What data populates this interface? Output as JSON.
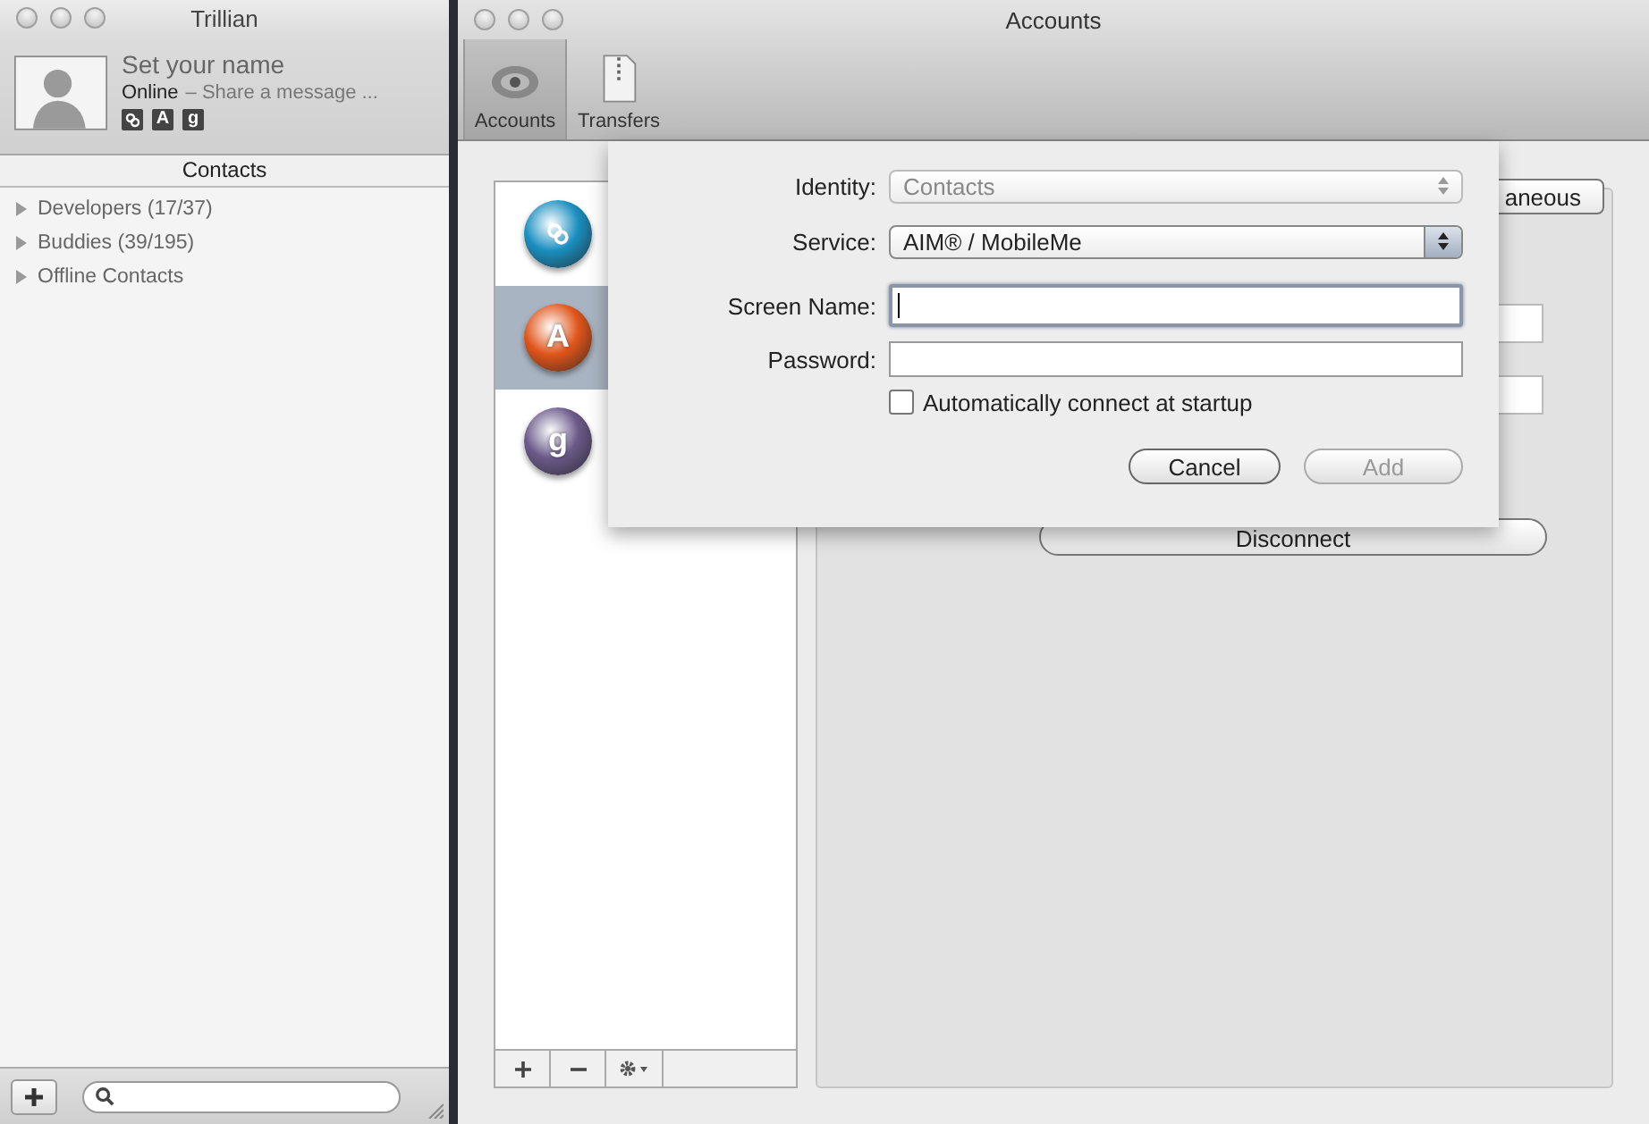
{
  "trillian": {
    "title": "Trillian",
    "profile": {
      "name": "Set your name",
      "status": "Online",
      "message": "– Share a message ...",
      "services": [
        {
          "kind": "swirl"
        },
        {
          "kind": "letter",
          "glyph": "A"
        },
        {
          "kind": "letter",
          "glyph": "g"
        }
      ]
    },
    "contacts_header": "Contacts",
    "groups": [
      {
        "label": "Developers (17/37)",
        "expanded": false
      },
      {
        "label": "Buddies (39/195)",
        "expanded": false
      },
      {
        "label": "Offline Contacts",
        "expanded": false
      }
    ]
  },
  "accounts_window": {
    "title": "Accounts",
    "toolbar": [
      {
        "label": "Accounts",
        "kind": "eye",
        "selected": true
      },
      {
        "label": "Transfers",
        "kind": "zip",
        "selected": false
      }
    ],
    "accounts": [
      {
        "kind": "swirl",
        "selected": false
      },
      {
        "kind": "letter",
        "glyph": "A",
        "selected": true
      },
      {
        "kind": "letter",
        "glyph": "g",
        "selected": false
      }
    ],
    "tab_label": "aneous",
    "disconnect": "Disconnect"
  },
  "sheet": {
    "identity": {
      "label": "Identity:",
      "value": "Contacts",
      "disabled": true
    },
    "service": {
      "label": "Service:",
      "value": "AIM® / MobileMe",
      "disabled": false
    },
    "screen_name": {
      "label": "Screen Name:",
      "focused": true
    },
    "password": {
      "label": "Password:",
      "focused": false
    },
    "auto_connect": {
      "label": "Automatically connect at startup",
      "checked": false
    },
    "buttons": [
      {
        "label": "Cancel",
        "disabled": false
      },
      {
        "label": "Add",
        "disabled": true
      }
    ]
  }
}
